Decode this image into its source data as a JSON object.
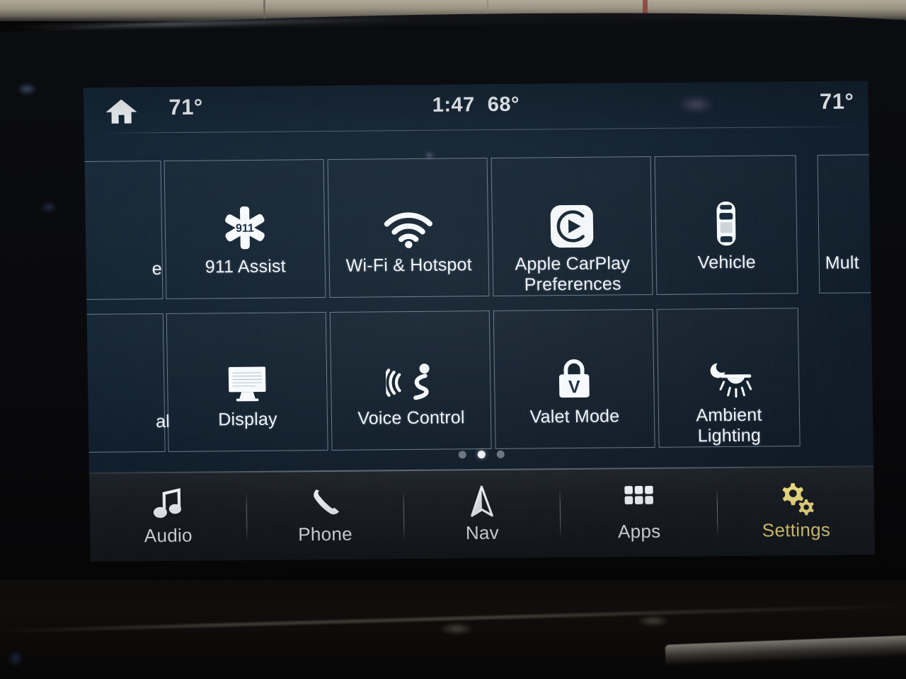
{
  "device": {
    "kind": "vehicle-infotainment-touchscreen"
  },
  "status_bar": {
    "home_icon": "home-icon",
    "left_temperature": "71°",
    "clock": "1:47",
    "outside_temperature": "68°",
    "right_temperature": "71°"
  },
  "grid": {
    "tiles": [
      {
        "label": "",
        "icon": "partial-tile-left-top",
        "partial": true,
        "row": 0,
        "col": 0
      },
      {
        "label": "911 Assist",
        "icon": "star-of-life-911-icon",
        "partial": false,
        "row": 0,
        "col": 1
      },
      {
        "label": "Wi-Fi & Hotspot",
        "icon": "wifi-icon",
        "partial": false,
        "row": 0,
        "col": 2
      },
      {
        "label": "Apple CarPlay Preferences",
        "icon": "apple-carplay-icon",
        "partial": false,
        "row": 0,
        "col": 3
      },
      {
        "label": "Vehicle",
        "icon": "car-top-view-icon",
        "partial": false,
        "row": 0,
        "col": 4
      },
      {
        "label": "Mult",
        "icon": "partial-tile-right-top",
        "partial": true,
        "row": 0,
        "col": 5
      },
      {
        "label": "",
        "icon": "partial-tile-left-bottom",
        "partial": true,
        "row": 1,
        "col": 0
      },
      {
        "label": "Display",
        "icon": "monitor-icon",
        "partial": false,
        "row": 1,
        "col": 1
      },
      {
        "label": "Voice Control",
        "icon": "voice-control-icon",
        "partial": false,
        "row": 1,
        "col": 2
      },
      {
        "label": "Valet Mode",
        "icon": "padlock-valet-icon",
        "partial": false,
        "row": 1,
        "col": 3
      },
      {
        "label": "Ambient Lighting",
        "icon": "moon-lamp-icon",
        "partial": false,
        "row": 1,
        "col": 4
      }
    ],
    "left_edge_top_text": "e",
    "left_edge_bottom_text": "al"
  },
  "pagination": {
    "total_pages": 3,
    "active_page": 2
  },
  "nav_bar": {
    "items": [
      {
        "label": "Audio",
        "icon": "music-note-icon",
        "active": false
      },
      {
        "label": "Phone",
        "icon": "phone-handset-icon",
        "active": false
      },
      {
        "label": "Nav",
        "icon": "navigation-arrow-icon",
        "active": false
      },
      {
        "label": "Apps",
        "icon": "apps-grid-icon",
        "active": false
      },
      {
        "label": "Settings",
        "icon": "gears-icon",
        "active": true
      }
    ]
  },
  "colors": {
    "screen_bg": "#10202f",
    "tile_border": "#c4d7e8",
    "text": "#f0f4f8",
    "nav_bar_bg": "#171b21",
    "active_nav": "#e9d77f"
  }
}
